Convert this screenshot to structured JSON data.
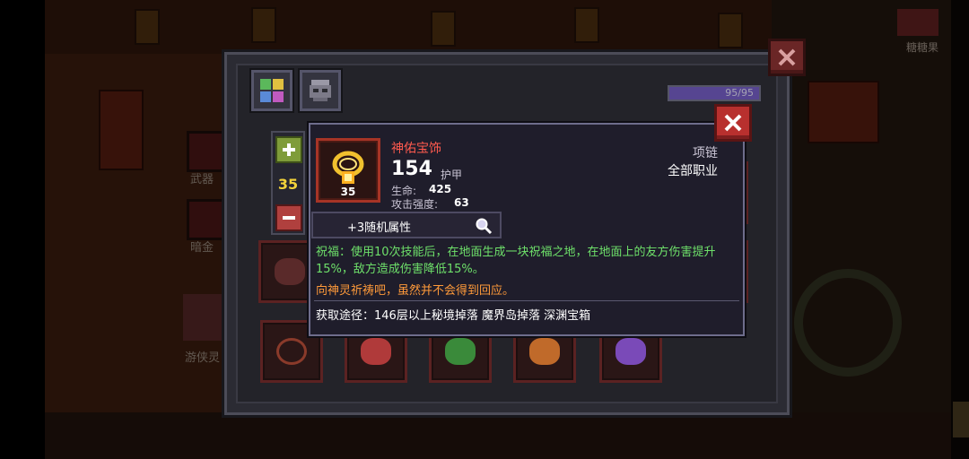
{
  "background": {
    "side_labels": [
      "武器",
      "暗金",
      "游侠灵"
    ],
    "corner_label": "糖糖果"
  },
  "panel": {
    "tabs": [
      {
        "icon": "grid-inventory-icon"
      },
      {
        "icon": "helmet-armor-icon"
      }
    ],
    "hp": {
      "text": "95/95",
      "fraction": 1.0
    },
    "quantity": "35"
  },
  "item": {
    "name": "神佑宝饰",
    "level": "35",
    "armor_value": "154",
    "armor_label": "护甲",
    "stats": [
      {
        "label": "生命:",
        "value": "425"
      },
      {
        "label": "攻击强度:",
        "value": "63"
      }
    ],
    "slot_type": "项链",
    "class_req": "全部职业",
    "random_attr": "+3随机属性",
    "desc_green": "祝福：使用10次技能后，在地面生成一块祝福之地，在地面上的友方伤害提升15%，敌方造成伤害降低15%。",
    "desc_orange": "向神灵祈祷吧，虽然并不会得到回应。",
    "source": "获取途径：146层以上秘境掉落 魔界岛掉落 深渊宝箱"
  },
  "colors": {
    "item_name": "#ff5a4e",
    "desc_green": "#6ee06a",
    "desc_orange": "#ff9a3a",
    "close_red": "#b8302e"
  }
}
